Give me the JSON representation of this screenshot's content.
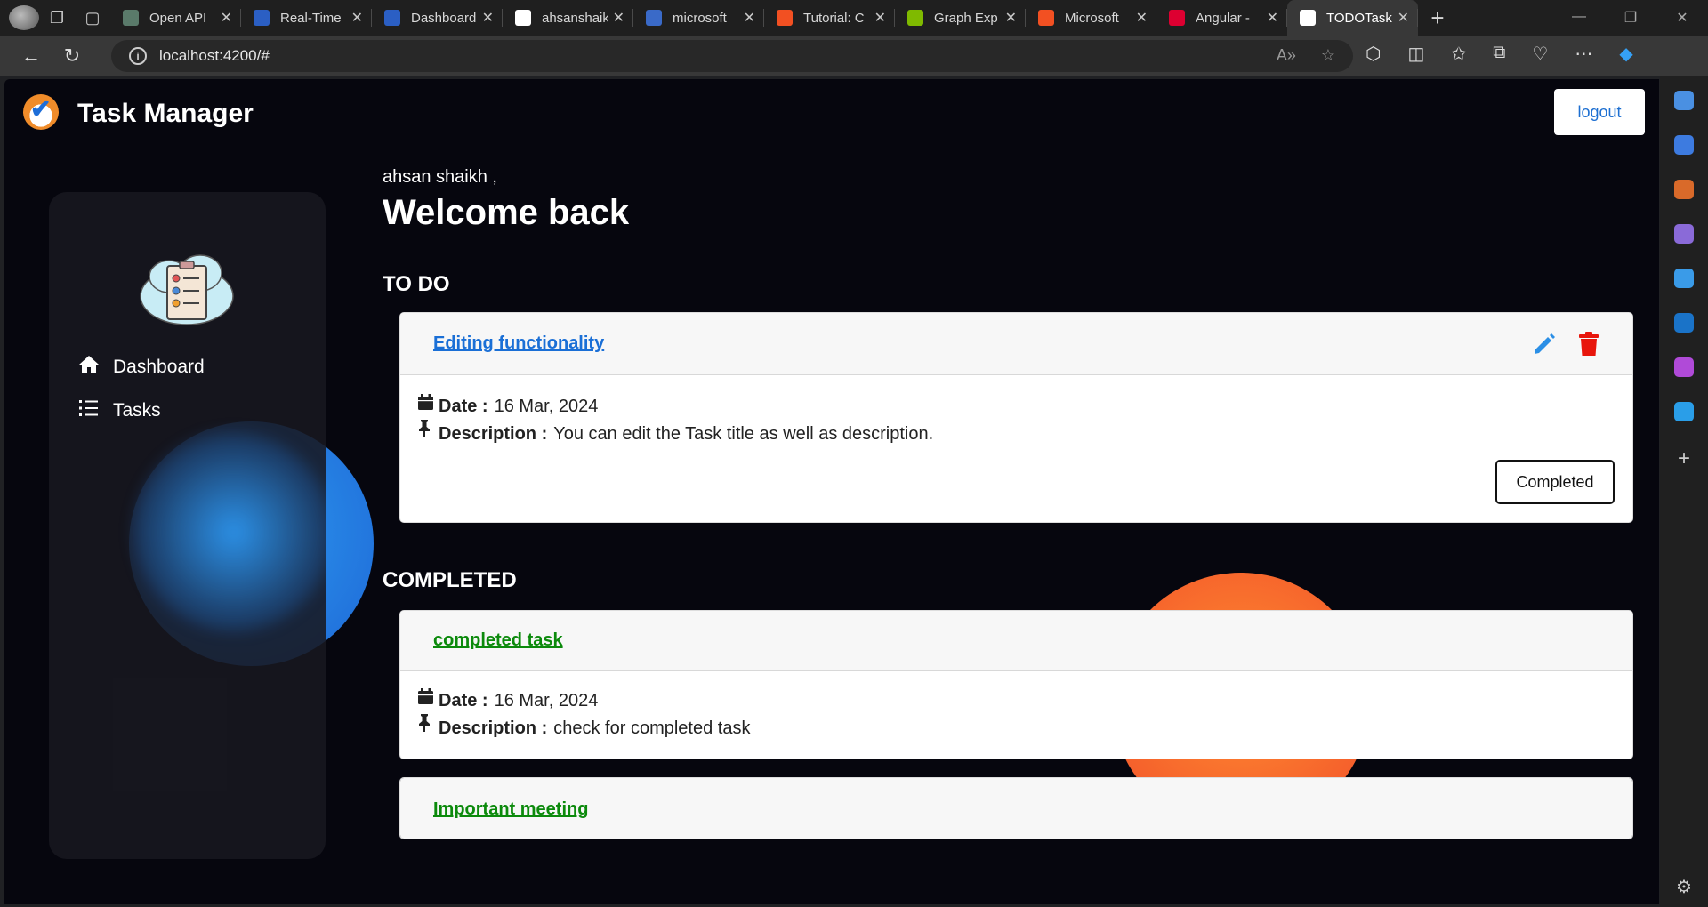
{
  "browser": {
    "tabs": [
      {
        "label": "Open API",
        "color": "#5a7a6a",
        "active": false
      },
      {
        "label": "Real-Time",
        "color": "#2b5fc4",
        "active": false
      },
      {
        "label": "Dashboard",
        "color": "#2b5fc4",
        "active": false
      },
      {
        "label": "ahsanshaikh",
        "color": "#ffffff",
        "active": false
      },
      {
        "label": "microsoft",
        "color": "#3a6ac8",
        "active": false
      },
      {
        "label": "Tutorial: C",
        "color": "#f25022",
        "active": false
      },
      {
        "label": "Graph Exp",
        "color": "#7fba00",
        "active": false
      },
      {
        "label": "Microsoft",
        "color": "#f25022",
        "active": false
      },
      {
        "label": "Angular -",
        "color": "#dd0031",
        "active": false
      },
      {
        "label": "TODOTask",
        "color": "#ffffff",
        "active": true
      }
    ],
    "url": "localhost:4200/#"
  },
  "app": {
    "title": "Task Manager",
    "logout_label": "logout",
    "sidebar": {
      "items": [
        {
          "label": "Dashboard",
          "icon": "home-icon"
        },
        {
          "label": "Tasks",
          "icon": "list-icon"
        }
      ]
    },
    "greeting": "ahsan shaikh ,",
    "welcome": "Welcome back",
    "sections": {
      "todo_title": "TO DO",
      "completed_title": "COMPLETED"
    },
    "todo": [
      {
        "title": "Editing functionality",
        "date_label": "Date :",
        "date": "16 Mar, 2024",
        "desc_label": "Description :",
        "description": "You can edit the Task title as well as description.",
        "action_label": "Completed"
      }
    ],
    "completed": [
      {
        "title": "completed task",
        "date_label": "Date :",
        "date": "16 Mar, 2024",
        "desc_label": "Description :",
        "description": "check for completed task"
      },
      {
        "title": "Important meeting"
      }
    ]
  },
  "colors": {
    "todo_link": "#1a6fd6",
    "completed_link": "#0c8a0c",
    "edit_icon": "#2b8fe6",
    "delete_icon": "#e8160c"
  }
}
